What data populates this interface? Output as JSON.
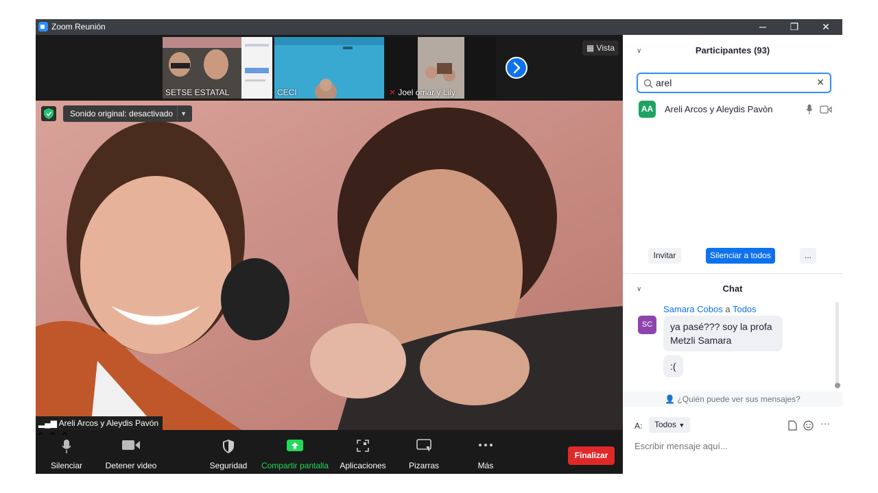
{
  "window": {
    "title": "Zoom Reunión",
    "minimize": "─",
    "restore": "❐",
    "close": "✕"
  },
  "thumbnails": [
    {
      "label": "SETSE ESTATAL",
      "muted": false
    },
    {
      "label": "CECI",
      "muted": false
    },
    {
      "label": "Joel omar y Lily",
      "muted": true
    }
  ],
  "view_button": {
    "label": "Vista",
    "icon": "grid-icon"
  },
  "main_video": {
    "sound_label": "Sonido original: desactivado",
    "speaker_name": "Areli Arcos y Aleydis Pavón"
  },
  "toolbar": {
    "items": [
      {
        "label": "Silenciar",
        "icon": "microphone-icon"
      },
      {
        "label": "Detener video",
        "icon": "video-camera-icon"
      },
      {
        "label": "Seguridad",
        "icon": "shield-icon"
      },
      {
        "label": "Compartir pantalla",
        "icon": "share-screen-icon"
      },
      {
        "label": "Aplicaciones",
        "icon": "apps-icon"
      },
      {
        "label": "Pizarras",
        "icon": "whiteboard-icon"
      },
      {
        "label": "Más",
        "icon": "more-icon"
      }
    ],
    "end_label": "Finalizar",
    "share_color": "#23d959",
    "end_color": "#e02828"
  },
  "participants": {
    "title": "Participantes (93)",
    "search_value": "arel",
    "list": [
      {
        "initials": "AA",
        "name": "Areli Arcos y Aleydis Pavòn"
      }
    ],
    "invite_label": "Invitar",
    "mute_all_label": "Silenciar a todos",
    "more_label": "..."
  },
  "chat": {
    "title": "Chat",
    "sender": "Samara Cobos",
    "to_word": "a",
    "recipient": "Todos",
    "avatar_initials": "SC",
    "messages": [
      "ya pasé??? soy la profa Metzli Samara",
      ":("
    ],
    "who_can_see": "¿Quién puede ver sus mensajes?",
    "to_label": "A:",
    "to_select": "Todos",
    "placeholder": "Escribir mensaje aquí..."
  },
  "colors": {
    "accent": "#0e72ed",
    "titlebar": "#3b3e43",
    "avatar_green": "#1ea362",
    "avatar_purple": "#8e44ad"
  }
}
